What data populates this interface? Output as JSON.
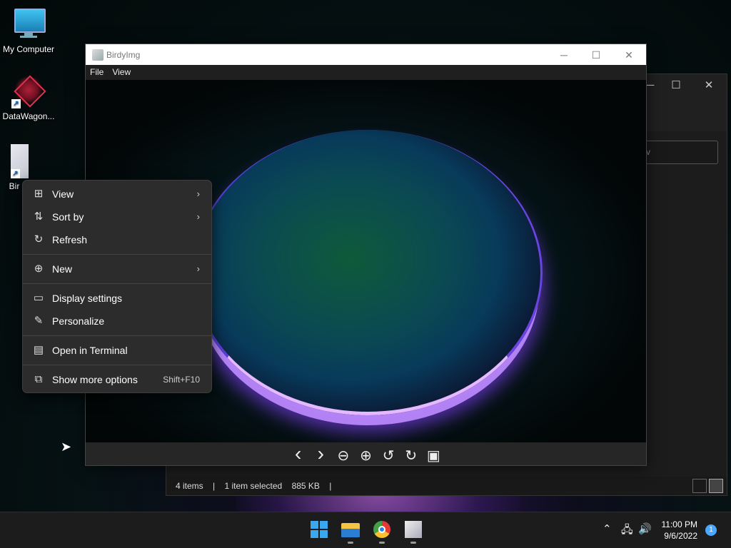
{
  "desktop": {
    "icons": [
      {
        "label": "My Computer"
      },
      {
        "label": "DataWagon..."
      },
      {
        "label": "Bir"
      }
    ]
  },
  "background_window": {
    "minimize": "─",
    "maximize": "☐",
    "close": "✕",
    "search_placeholder": "v",
    "status": {
      "items": "4 items",
      "selected": "1 item selected",
      "size": "885 KB",
      "sep": "|"
    }
  },
  "viewer": {
    "title": "BirdyImg",
    "minimize": "─",
    "maximize": "☐",
    "close": "✕",
    "menu": [
      "File",
      "View"
    ],
    "toolbar": {
      "prev": "‹",
      "next": "›",
      "zoom_out": "⊖",
      "zoom_in": "⊕",
      "rotate_left": "↺",
      "rotate_right": "↻",
      "gallery": "▣"
    }
  },
  "context_menu": {
    "items": [
      {
        "label": "View",
        "icon": "grid-icon",
        "glyph": "⊞",
        "arrow": "›"
      },
      {
        "label": "Sort by",
        "icon": "sort-icon",
        "glyph": "⇅",
        "arrow": "›"
      },
      {
        "label": "Refresh",
        "icon": "refresh-icon",
        "glyph": "↻"
      },
      {
        "label": "New",
        "icon": "plus-circle-icon",
        "glyph": "⊕",
        "arrow": "›"
      },
      {
        "label": "Display settings",
        "icon": "display-icon",
        "glyph": "▭"
      },
      {
        "label": "Personalize",
        "icon": "pen-icon",
        "glyph": "✎"
      },
      {
        "label": "Open in Terminal",
        "icon": "terminal-icon",
        "glyph": "▤"
      },
      {
        "label": "Show more options",
        "icon": "more-options-icon",
        "glyph": "⧉",
        "shortcut": "Shift+F10"
      }
    ]
  },
  "taskbar": {
    "tray_chevron": "⌃",
    "network": "🖧",
    "volume": "🔊",
    "time": "11:00 PM",
    "date": "9/6/2022",
    "notifications": "1"
  }
}
